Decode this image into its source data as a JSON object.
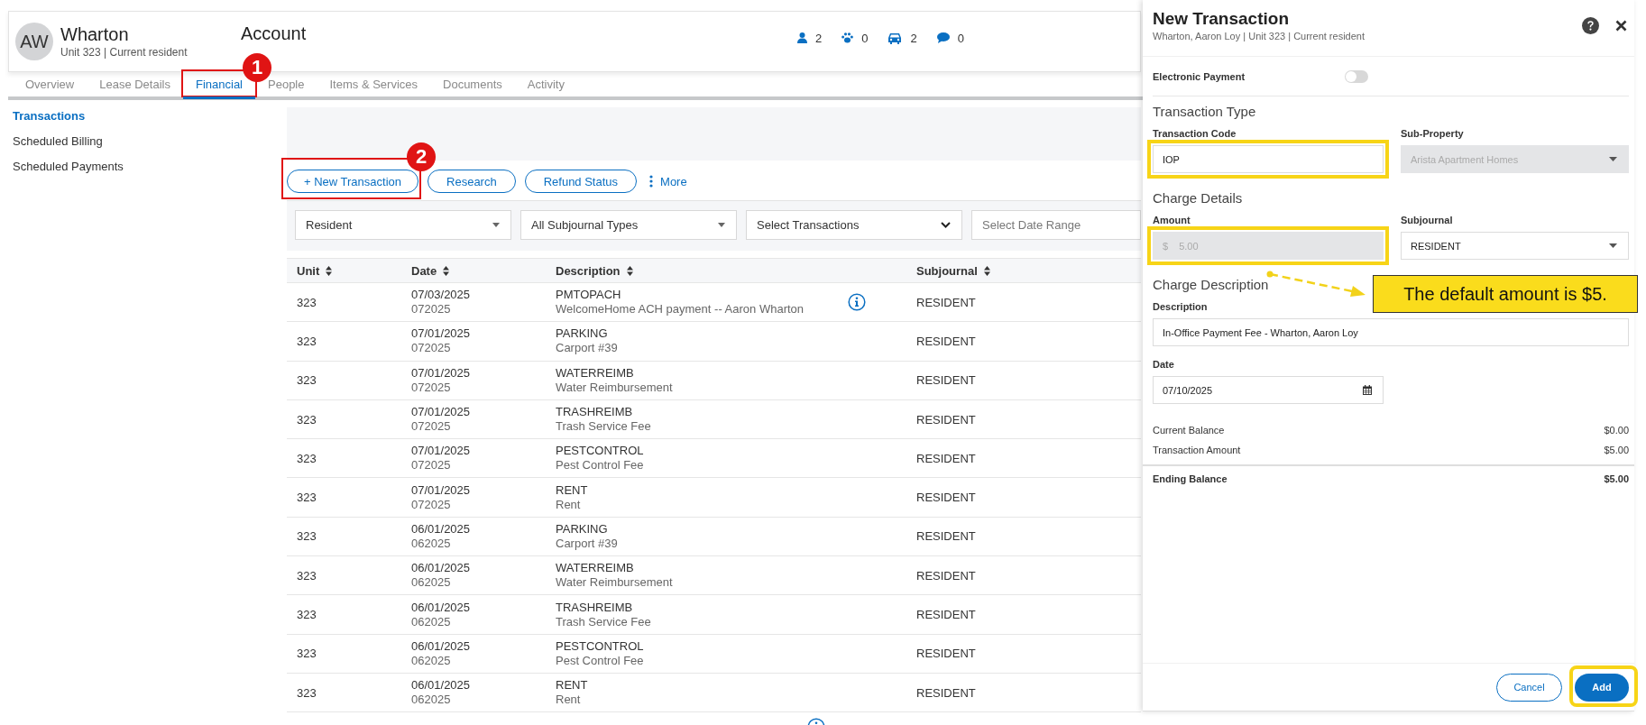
{
  "header": {
    "avatar_initials": "AW",
    "name": "Wharton",
    "subtitle": "Unit 323 | Current resident",
    "title": "Account",
    "counts": [
      {
        "kind": "people",
        "value": "2"
      },
      {
        "kind": "pets",
        "value": "0"
      },
      {
        "kind": "vehicles",
        "value": "2"
      },
      {
        "kind": "messages",
        "value": "0"
      }
    ]
  },
  "tabs": [
    {
      "label": "Overview",
      "selected": false
    },
    {
      "label": "Lease Details",
      "selected": false
    },
    {
      "label": "Financial",
      "selected": true,
      "step": "1"
    },
    {
      "label": "People",
      "selected": false
    },
    {
      "label": "Items & Services",
      "selected": false
    },
    {
      "label": "Documents",
      "selected": false
    },
    {
      "label": "Activity",
      "selected": false
    }
  ],
  "sidebar": {
    "items": [
      {
        "label": "Transactions",
        "selected": true
      },
      {
        "label": "Scheduled Billing",
        "selected": false
      },
      {
        "label": "Scheduled Payments",
        "selected": false
      }
    ]
  },
  "actions": [
    {
      "label": "+ New Transaction",
      "step": "2"
    },
    {
      "label": "Research"
    },
    {
      "label": "Refund Status"
    }
  ],
  "more": {
    "label": "More"
  },
  "filters": [
    {
      "kind": "select",
      "value": "Resident"
    },
    {
      "kind": "select",
      "value": "All Subjournal Types"
    },
    {
      "kind": "dropdown",
      "value": "Select Transactions"
    },
    {
      "kind": "date",
      "placeholder": "Select Date Range"
    }
  ],
  "table": {
    "columns": [
      "Unit",
      "Date",
      "Description",
      "Subjournal"
    ],
    "rows": [
      {
        "unit": "323",
        "date": "07/03/2025",
        "period": "072025",
        "code": "PMTOPACH",
        "description": "WelcomeHome ACH payment -- Aaron Wharton",
        "info": true,
        "subjournal": "RESIDENT"
      },
      {
        "unit": "323",
        "date": "07/01/2025",
        "period": "072025",
        "code": "PARKING",
        "description": "Carport #39",
        "info": false,
        "subjournal": "RESIDENT"
      },
      {
        "unit": "323",
        "date": "07/01/2025",
        "period": "072025",
        "code": "WATERREIMB",
        "description": "Water Reimbursement",
        "info": false,
        "subjournal": "RESIDENT"
      },
      {
        "unit": "323",
        "date": "07/01/2025",
        "period": "072025",
        "code": "TRASHREIMB",
        "description": "Trash Service Fee",
        "info": false,
        "subjournal": "RESIDENT"
      },
      {
        "unit": "323",
        "date": "07/01/2025",
        "period": "072025",
        "code": "PESTCONTROL",
        "description": "Pest Control Fee",
        "info": false,
        "subjournal": "RESIDENT"
      },
      {
        "unit": "323",
        "date": "07/01/2025",
        "period": "072025",
        "code": "RENT",
        "description": "Rent",
        "info": false,
        "subjournal": "RESIDENT"
      },
      {
        "unit": "323",
        "date": "06/01/2025",
        "period": "062025",
        "code": "PARKING",
        "description": "Carport #39",
        "info": false,
        "subjournal": "RESIDENT"
      },
      {
        "unit": "323",
        "date": "06/01/2025",
        "period": "062025",
        "code": "WATERREIMB",
        "description": "Water Reimbursement",
        "info": false,
        "subjournal": "RESIDENT"
      },
      {
        "unit": "323",
        "date": "06/01/2025",
        "period": "062025",
        "code": "TRASHREIMB",
        "description": "Trash Service Fee",
        "info": false,
        "subjournal": "RESIDENT"
      },
      {
        "unit": "323",
        "date": "06/01/2025",
        "period": "062025",
        "code": "PESTCONTROL",
        "description": "Pest Control Fee",
        "info": false,
        "subjournal": "RESIDENT"
      },
      {
        "unit": "323",
        "date": "06/01/2025",
        "period": "062025",
        "code": "RENT",
        "description": "Rent",
        "info": false,
        "subjournal": "RESIDENT"
      },
      {
        "info": true
      }
    ]
  },
  "panel": {
    "title": "New Transaction",
    "subtitle": "Wharton, Aaron Loy | Unit 323 | Current resident",
    "electronic_payment": {
      "label": "Electronic Payment",
      "on": false
    },
    "transaction_type": {
      "heading": "Transaction Type",
      "code": {
        "label": "Transaction Code",
        "value": "IOP",
        "highlighted": true
      },
      "sub_property": {
        "label": "Sub-Property",
        "value": "Arista Apartment Homes",
        "disabled": true
      }
    },
    "charge_details": {
      "heading": "Charge Details",
      "amount": {
        "label": "Amount",
        "currency": "$",
        "value": "5.00",
        "disabled": true,
        "highlighted": true
      },
      "subjournal": {
        "label": "Subjournal",
        "value": "RESIDENT"
      }
    },
    "charge_description": {
      "heading": "Charge Description",
      "description": {
        "label": "Description",
        "value": "In-Office Payment Fee - Wharton, Aaron Loy"
      },
      "date": {
        "label": "Date",
        "value": "07/10/2025"
      }
    },
    "summary": [
      {
        "kind": "line",
        "label": "Current Balance",
        "value": "$0.00"
      },
      {
        "kind": "line",
        "label": "Transaction Amount",
        "value": "$5.00"
      },
      {
        "kind": "total",
        "label": "Ending Balance",
        "value": "$5.00"
      }
    ],
    "buttons": [
      {
        "kind": "secondary",
        "label": "Cancel",
        "highlighted": false
      },
      {
        "kind": "primary",
        "label": "Add",
        "highlighted": true
      }
    ],
    "callout": {
      "text": "The default amount is $5."
    }
  }
}
